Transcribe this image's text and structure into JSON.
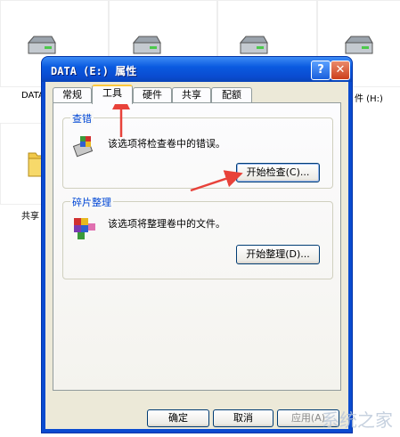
{
  "desktop": {
    "labels": {
      "data": "DATA",
      "drive_h": "件 (H:)",
      "shared": "共享"
    }
  },
  "dialog": {
    "title": "DATA (E:) 属性",
    "help_label": "?",
    "close_label": "✕",
    "tabs": [
      {
        "label": "常规"
      },
      {
        "label": "工具",
        "active": true
      },
      {
        "label": "硬件"
      },
      {
        "label": "共享"
      },
      {
        "label": "配额"
      }
    ],
    "error_check": {
      "title": "查错",
      "description": "该选项将检查卷中的错误。",
      "button": "开始检查(C)..."
    },
    "defrag": {
      "title": "碎片整理",
      "description": "该选项将整理卷中的文件。",
      "button": "开始整理(D)..."
    },
    "footer": {
      "ok": "确定",
      "cancel": "取消",
      "apply": "应用(A)"
    }
  },
  "watermark": "系统之家",
  "colors": {
    "title_bar": "#0a4bd0",
    "client_bg": "#ece9d8",
    "group_title": "#0046d5",
    "arrow": "#e8423a"
  }
}
